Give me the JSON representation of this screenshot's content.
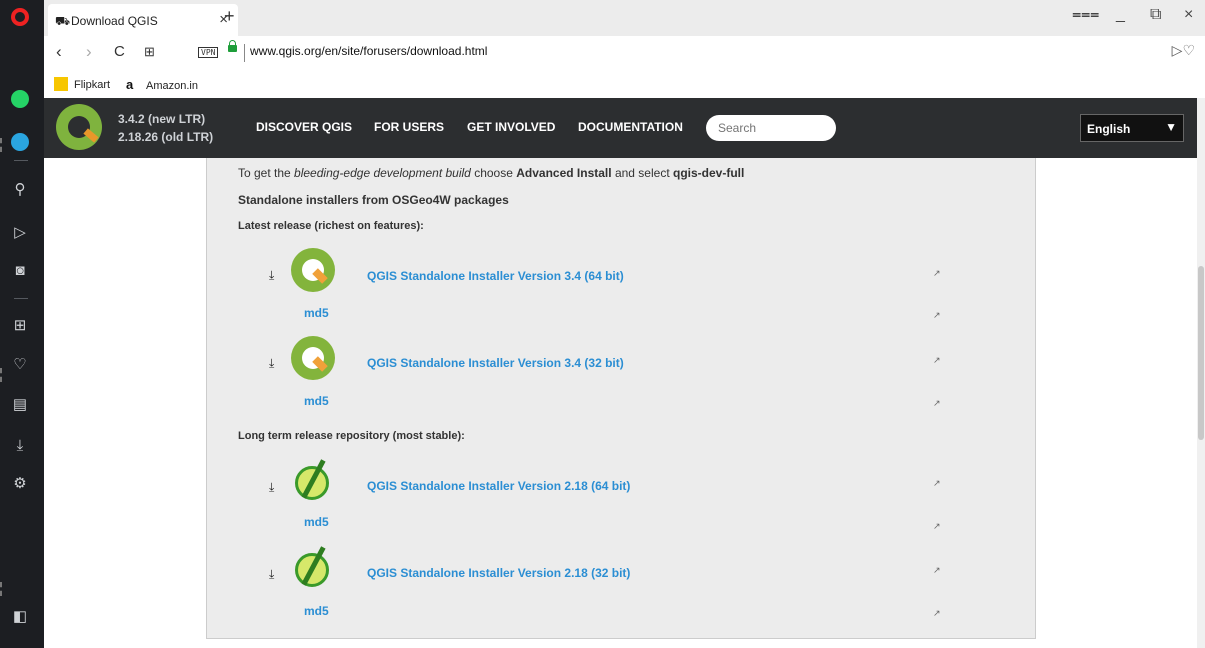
{
  "browser": {
    "tab_title": "Download QGIS",
    "tab_close": "×",
    "new_tab": "+",
    "url": "www.qgis.org/en/site/forusers/download.html",
    "vpn_label": "VPN",
    "nav": {
      "back": "‹",
      "forward": "›",
      "reload": "C",
      "speed_dial": "⊞"
    },
    "window_controls": {
      "menu": "⩶",
      "minimize": "_",
      "restore": "⧉",
      "close": "×"
    },
    "url_right_icons": "▷♡"
  },
  "bookmarks": [
    {
      "label": "Flipkart",
      "color": "#f7c600"
    },
    {
      "label": "Amazon.in",
      "color": "#111111"
    }
  ],
  "qgis_header": {
    "version_new": "3.4.2 (new LTR)",
    "version_old": "2.18.26 (old LTR)",
    "nav": [
      "DISCOVER QGIS",
      "FOR USERS",
      "GET INVOLVED",
      "DOCUMENTATION"
    ],
    "search_placeholder": "Search",
    "language": "English",
    "language_arrow": "▼",
    "logo_color": "#7fb33e"
  },
  "content": {
    "intro_part1": "To get the ",
    "intro_italic": "bleeding-edge development build",
    "intro_part2": " choose ",
    "intro_bold1": "Advanced Install",
    "intro_part3": " and select ",
    "intro_bold2": "qgis-dev-full",
    "section_title": "Standalone installers from OSGeo4W packages",
    "latest_label": "Latest release (richest on features):",
    "ltr_label": "Long term release repository (most stable):",
    "download_icon": "⤓",
    "external_icon": "↗",
    "installers_latest": [
      {
        "label": "QGIS Standalone Installer Version 3.4 (64 bit)",
        "md5": "md5"
      },
      {
        "label": "QGIS Standalone Installer Version 3.4 (32 bit)",
        "md5": "md5"
      }
    ],
    "installers_ltr": [
      {
        "label": "QGIS Standalone Installer Version 2.18 (64 bit)",
        "md5": "md5"
      },
      {
        "label": "QGIS Standalone Installer Version 2.18 (32 bit)",
        "md5": "md5"
      }
    ]
  },
  "colors": {
    "link": "#2b8ed3",
    "header_bg": "#2c2e30",
    "panel_bg": "#ececec"
  }
}
